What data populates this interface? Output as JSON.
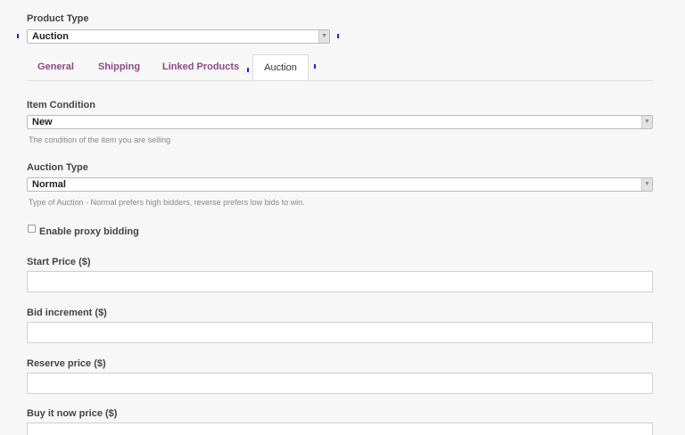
{
  "product_type": {
    "label": "Product Type",
    "value": "Auction"
  },
  "tabs": [
    {
      "label": "General"
    },
    {
      "label": "Shipping"
    },
    {
      "label": "Linked Products"
    },
    {
      "label": "Auction"
    }
  ],
  "item_condition": {
    "label": "Item Condition",
    "value": "New",
    "hint": "The condition of the item you are selling"
  },
  "auction_type": {
    "label": "Auction Type",
    "value": "Normal",
    "hint": "Type of Auction - Normal prefers high bidders, reverse prefers low bids to win."
  },
  "proxy_bidding": {
    "label": "Enable proxy bidding",
    "checked": false
  },
  "start_price": {
    "label": "Start Price ($)",
    "value": ""
  },
  "bid_increment": {
    "label": "Bid increment ($)",
    "value": ""
  },
  "reserve_price": {
    "label": "Reserve price ($)",
    "value": ""
  },
  "buy_it_now": {
    "label": "Buy it now price ($)",
    "value": ""
  },
  "colors": {
    "tab_link": "#8a4a87",
    "marker": "#2020d8",
    "background": "#f7f7f7"
  }
}
